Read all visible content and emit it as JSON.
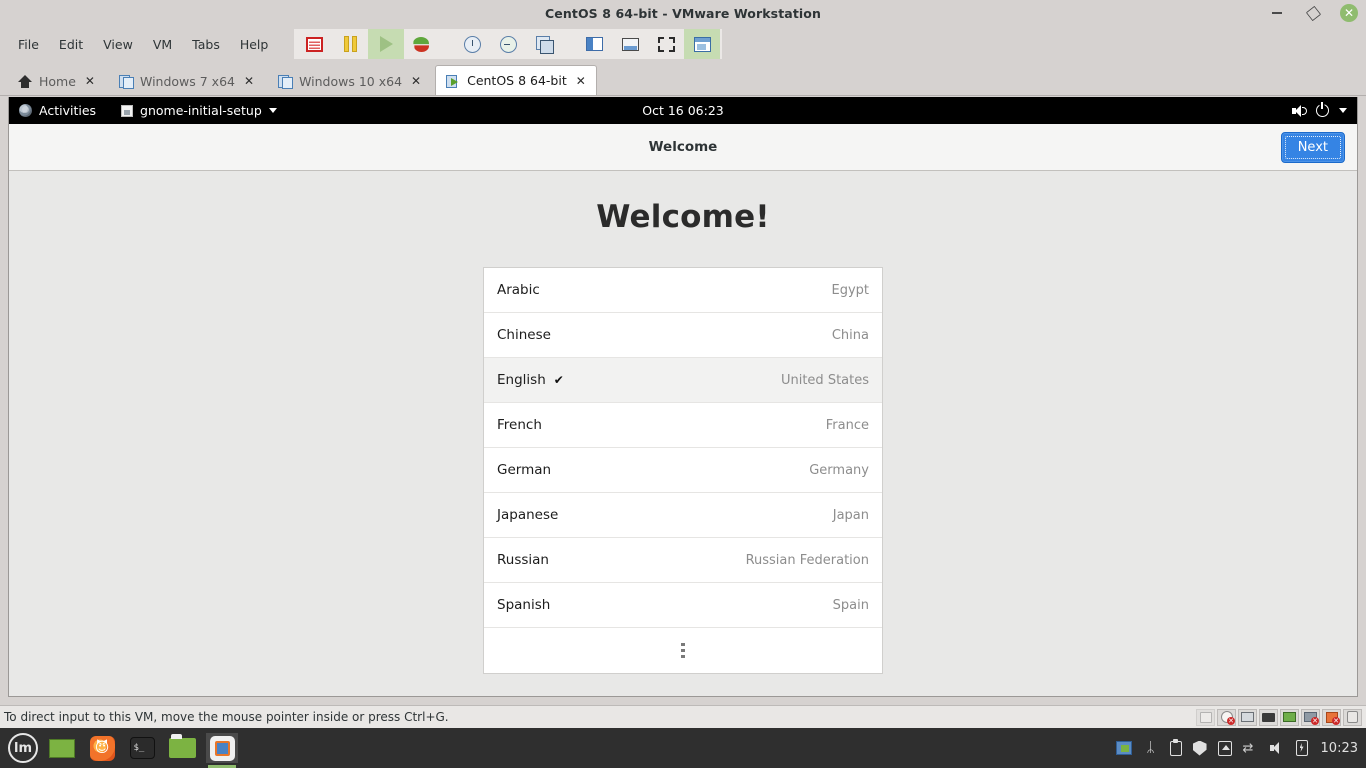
{
  "window": {
    "title": "CentOS 8 64-bit - VMware Workstation",
    "controls": {
      "minimize": "minimize-icon",
      "restore": "restore-icon",
      "close": "close-icon"
    }
  },
  "menubar": {
    "items": [
      {
        "label": "File"
      },
      {
        "label": "Edit"
      },
      {
        "label": "View"
      },
      {
        "label": "VM"
      },
      {
        "label": "Tabs"
      },
      {
        "label": "Help"
      }
    ]
  },
  "toolbar": {
    "buttons": [
      {
        "name": "snapshot-icon"
      },
      {
        "name": "suspend-icon"
      },
      {
        "name": "power-on-icon"
      },
      {
        "name": "reset-icon"
      },
      {
        "name": "snapshot-manager-icon"
      },
      {
        "name": "revert-snapshot-icon"
      },
      {
        "name": "manage-snapshots-icon"
      },
      {
        "name": "show-sidebar-icon"
      },
      {
        "name": "console-view-icon"
      },
      {
        "name": "fullscreen-icon"
      },
      {
        "name": "unity-mode-icon"
      }
    ]
  },
  "tabs": [
    {
      "label": "Home",
      "icon": "home-icon",
      "active": false,
      "close": "✕"
    },
    {
      "label": "Windows 7 x64",
      "icon": "vm-icon",
      "active": false,
      "close": "✕"
    },
    {
      "label": "Windows 10 x64",
      "icon": "vm-icon",
      "active": false,
      "close": "✕"
    },
    {
      "label": "CentOS 8 64-bit",
      "icon": "vm-running-icon",
      "active": true,
      "close": "✕"
    }
  ],
  "gnome": {
    "activities": "Activities",
    "app_name": "gnome-initial-setup",
    "clock": "Oct 16  06:23",
    "indicators": [
      "volume-icon",
      "power-icon",
      "chevron-down-icon"
    ]
  },
  "setup": {
    "header_title": "Welcome",
    "next_label": "Next",
    "heading": "Welcome!",
    "languages": [
      {
        "name": "Arabic",
        "region": "Egypt",
        "selected": false
      },
      {
        "name": "Chinese",
        "region": "China",
        "selected": false
      },
      {
        "name": "English",
        "region": "United States",
        "selected": true,
        "check": "✔"
      },
      {
        "name": "French",
        "region": "France",
        "selected": false
      },
      {
        "name": "German",
        "region": "Germany",
        "selected": false
      },
      {
        "name": "Japanese",
        "region": "Japan",
        "selected": false
      },
      {
        "name": "Russian",
        "region": "Russian Federation",
        "selected": false
      },
      {
        "name": "Spanish",
        "region": "Spain",
        "selected": false
      }
    ],
    "more_indicator": "more-languages-icon"
  },
  "statusbar": {
    "message": "To direct input to this VM, move the mouse pointer inside or press Ctrl+G.",
    "devices": [
      {
        "name": "hard-disk-icon",
        "disabled": true
      },
      {
        "name": "cd-dvd-icon",
        "disconnected": true
      },
      {
        "name": "network-adapter-icon",
        "disconnected": false
      },
      {
        "name": "printer-icon",
        "disconnected": false
      },
      {
        "name": "sound-card-icon",
        "disconnected": false
      },
      {
        "name": "usb-controller-icon",
        "disconnected": true
      },
      {
        "name": "floppy-icon",
        "disconnected": true
      },
      {
        "name": "camera-icon",
        "disconnected": false
      }
    ]
  },
  "taskbar": {
    "menu_label": "lm",
    "apps": [
      {
        "name": "show-desktop-icon",
        "active": false
      },
      {
        "name": "firefox-icon",
        "active": false
      },
      {
        "name": "terminal-icon",
        "active": false
      },
      {
        "name": "files-icon",
        "active": false
      },
      {
        "name": "vmware-workstation-icon",
        "active": true
      }
    ],
    "tray": [
      "vmware-tray-icon",
      "bluetooth-icon",
      "clipboard-icon",
      "update-shield-icon",
      "eject-icon",
      "network-disconnected-icon",
      "volume-icon",
      "battery-icon"
    ],
    "clock": "10:23",
    "terminal_prompt": "$_",
    "bluetooth_glyph": "ᛦ",
    "network_glyph": "⇄"
  },
  "colors": {
    "accent_blue": "#3584e4",
    "titlebar_bg": "#d6d2d0",
    "vm_content_bg": "#e8e8e7",
    "gnome_bar_bg": "#000000",
    "taskbar_bg": "#2f2f2f",
    "close_green": "#8fbc6e"
  }
}
